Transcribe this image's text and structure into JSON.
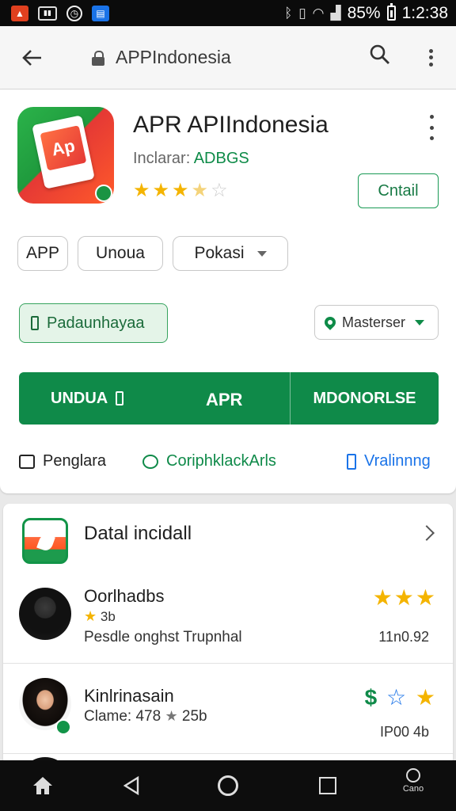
{
  "status_bar": {
    "battery_text": "85%",
    "time": "1:2:38"
  },
  "toolbar": {
    "url": "APPIndonesia"
  },
  "app": {
    "title": "APR APIIndonesia",
    "subtitle_prefix": "Inclarar:",
    "developer": "ADBGS",
    "rating": 3.5,
    "detail_button": "Cntail",
    "tags": [
      "APP",
      "Unoua",
      "Pokasi"
    ],
    "permission_button": "Padaunhayaa",
    "location_select": "Masterser",
    "install_left": "UNDUA",
    "install_mid": "APR",
    "install_right": "MDONORLSE",
    "links": [
      "Penglara",
      "CoriphklackArls",
      "Vralinnng"
    ]
  },
  "reviews": {
    "title": "Datal incidall",
    "items": [
      {
        "name": "Oorlhadbs",
        "meta": "3b",
        "text": "Pesdle onghst Trupnhal",
        "right_stars": "★★★",
        "number": "11n0.92"
      },
      {
        "name": "Kinlrinasain",
        "meta_prefix": "Clame: 478",
        "meta_suffix": "25b",
        "right_dollar": "$",
        "right_star_outline": "☆",
        "right_star": "★",
        "number": "IP00 4b"
      }
    ]
  },
  "nav": {
    "extra_label": "Cano"
  },
  "colors": {
    "brand_green": "#0f8a49",
    "star": "#f4b400",
    "link_blue": "#1a73e8"
  }
}
